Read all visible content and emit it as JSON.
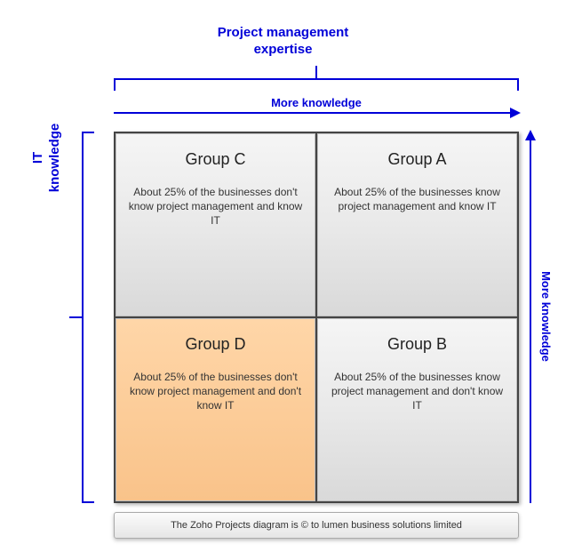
{
  "axes": {
    "top_title_line1": "Project management",
    "top_title_line2": "expertise",
    "top_arrow_label": "More knowledge",
    "left_title_line1": "IT",
    "left_title_line2": "knowledge",
    "right_arrow_label": "More knowledge"
  },
  "quadrants": {
    "top_left": {
      "title": "Group C",
      "body": "About 25% of the businesses don't know project management and know IT"
    },
    "top_right": {
      "title": "Group A",
      "body": "About 25% of the businesses know project management and know IT"
    },
    "bot_left": {
      "title": "Group D",
      "body": "About 25% of the businesses don't know project management and don't know IT",
      "highlight": true
    },
    "bot_right": {
      "title": "Group B",
      "body": "About 25% of the businesses know project management and don't know IT"
    }
  },
  "footer": "The Zoho Projects diagram is © to lumen business solutions limited",
  "chart_data": {
    "type": "table",
    "x_axis": "Project management expertise",
    "y_axis": "IT knowledge",
    "x_direction": "more knowledge to the right",
    "y_direction": "more knowledge upward",
    "cells": [
      {
        "pm_expertise": "low",
        "it_knowledge": "high",
        "group": "Group C",
        "share_of_businesses_pct": 25
      },
      {
        "pm_expertise": "high",
        "it_knowledge": "high",
        "group": "Group A",
        "share_of_businesses_pct": 25
      },
      {
        "pm_expertise": "low",
        "it_knowledge": "low",
        "group": "Group D",
        "share_of_businesses_pct": 25,
        "highlighted": true
      },
      {
        "pm_expertise": "high",
        "it_knowledge": "low",
        "group": "Group B",
        "share_of_businesses_pct": 25
      }
    ]
  }
}
